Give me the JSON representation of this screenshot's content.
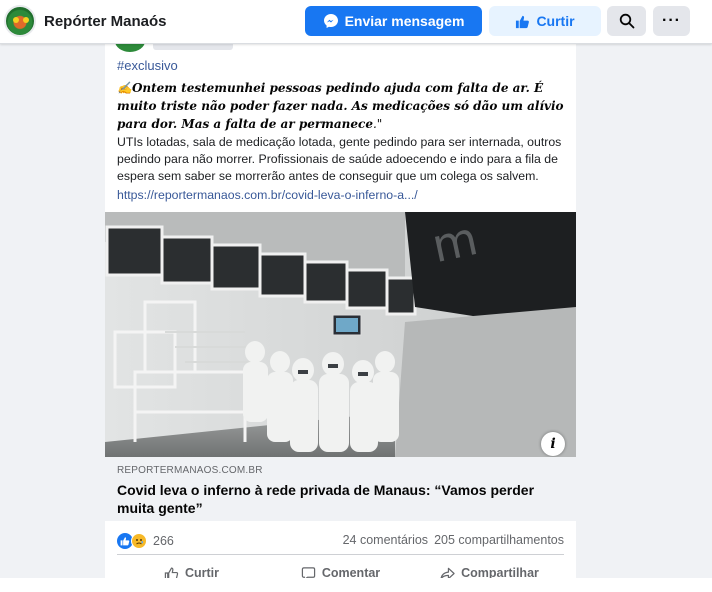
{
  "header": {
    "page_name": "Repórter Manaós",
    "message_button": "Enviar mensagem",
    "like_button": "Curtir",
    "more_glyph": "···"
  },
  "post": {
    "hashtag": "#exclusivo",
    "quote_prefix": "✍️",
    "quote_bold": "Ontem testemunhei pessoas pedindo ajuda com falta de ar",
    "quote_rest": ". É muito triste não poder fazer nada. As medicações só dão um alívio para dor. Mas a falta de ar permanece",
    "quote_end": ".\"",
    "body": "UTIs lotadas, sala de medicação lotada, gente pedindo para ser internada, outros pedindo para não morrer. Profissionais de saúde adoecendo e indo para a fila de espera sem saber se morrerão antes de conseguir que um colega os salvem.",
    "link": "https://reportermanaos.com.br/covid-leva-o-inferno-a.../",
    "image_info": "i"
  },
  "preview": {
    "domain": "REPORTERMANAOS.COM.BR",
    "headline": "Covid leva o inferno à rede privada de Manaus: “Vamos perder muita gente”"
  },
  "engagement": {
    "reaction_count": "266",
    "comments": "24 comentários",
    "shares": "205 compartilhamentos"
  },
  "actions": {
    "like": "Curtir",
    "comment": "Comentar",
    "share": "Compartilhar"
  },
  "colors": {
    "accent": "#1877f2",
    "link": "#385898",
    "muted": "#65676b"
  }
}
